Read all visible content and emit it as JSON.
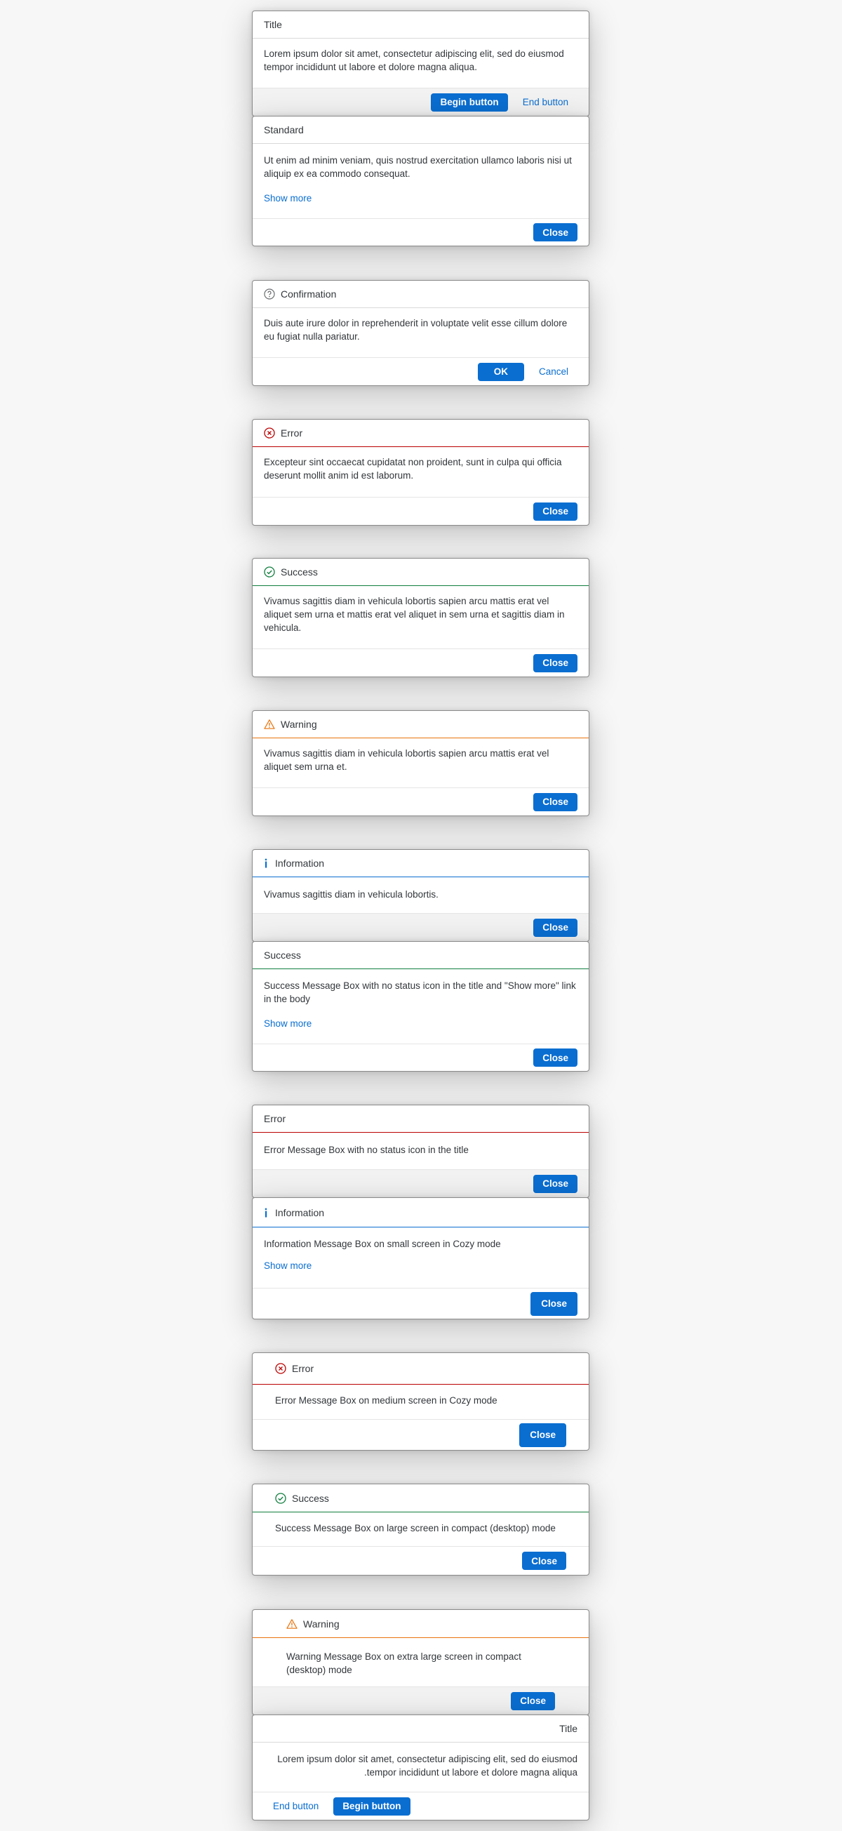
{
  "dialogs": {
    "d1": {
      "title": "Title",
      "body": "Lorem ipsum dolor sit amet, consectetur adipiscing elit, sed do eiusmod tempor incididunt ut labore et dolore magna aliqua.",
      "begin_button": "Begin button",
      "end_button": "End button"
    },
    "d2": {
      "title": "Standard",
      "body": "Ut enim ad minim veniam, quis nostrud exercitation ullamco laboris nisi ut aliquip ex ea commodo consequat.",
      "show_more": "Show more",
      "close": "Close"
    },
    "d3": {
      "title": "Confirmation",
      "body": "Duis aute irure dolor in reprehenderit in voluptate velit esse cillum dolore eu fugiat nulla pariatur.",
      "ok": "OK",
      "cancel": "Cancel"
    },
    "d4": {
      "title": "Error",
      "body": "Excepteur sint occaecat cupidatat non proident, sunt in culpa qui officia deserunt mollit anim id est laborum.",
      "close": "Close"
    },
    "d5": {
      "title": "Success",
      "body": "Vivamus sagittis diam in vehicula lobortis sapien arcu mattis erat vel aliquet sem urna et mattis erat vel aliquet in sem urna et sagittis diam in vehicula.",
      "close": "Close"
    },
    "d6": {
      "title": "Warning",
      "body": "Vivamus sagittis diam in vehicula lobortis sapien arcu mattis erat vel aliquet sem urna et.",
      "close": "Close"
    },
    "d7": {
      "title": "Information",
      "body": "Vivamus sagittis diam in vehicula lobortis.",
      "close": "Close"
    },
    "d8": {
      "title": "Success",
      "body": "Success Message Box with no status icon in the title and \"Show more\" link in the body",
      "show_more": "Show more",
      "close": "Close"
    },
    "d9": {
      "title": "Error",
      "body": "Error Message Box with no status icon in the title",
      "close": "Close"
    },
    "d10": {
      "title": "Information",
      "body": "Information Message Box on small screen in Cozy mode",
      "show_more": "Show more",
      "close": "Close"
    },
    "d11": {
      "title": "Error",
      "body": "Error Message Box on medium screen in Cozy mode",
      "close": "Close"
    },
    "d12": {
      "title": "Success",
      "body": "Success Message Box on large screen in compact (desktop) mode",
      "close": "Close"
    },
    "d13": {
      "title": "Warning",
      "body": "Warning Message Box on extra large screen in compact (desktop) mode",
      "close": "Close"
    },
    "d14": {
      "title": "Title",
      "body_line1": "Lorem ipsum dolor sit amet, consectetur adipiscing elit, sed do eiusmod",
      "body_line2": ".tempor incididunt ut labore et dolore magna aliqua",
      "end_button": "End button",
      "begin_button": "Begin button"
    }
  },
  "colors": {
    "accent": "#0a6ed1",
    "error": "#bb0000",
    "success": "#107e3e",
    "warning": "#e9730c",
    "information": "#0a6ed1",
    "neutral_icon": "#6a6d70"
  },
  "icons": {
    "confirmation": "question-circle-icon",
    "error": "error-circle-icon",
    "success": "success-circle-icon",
    "warning": "warning-triangle-icon",
    "information": "info-icon"
  }
}
